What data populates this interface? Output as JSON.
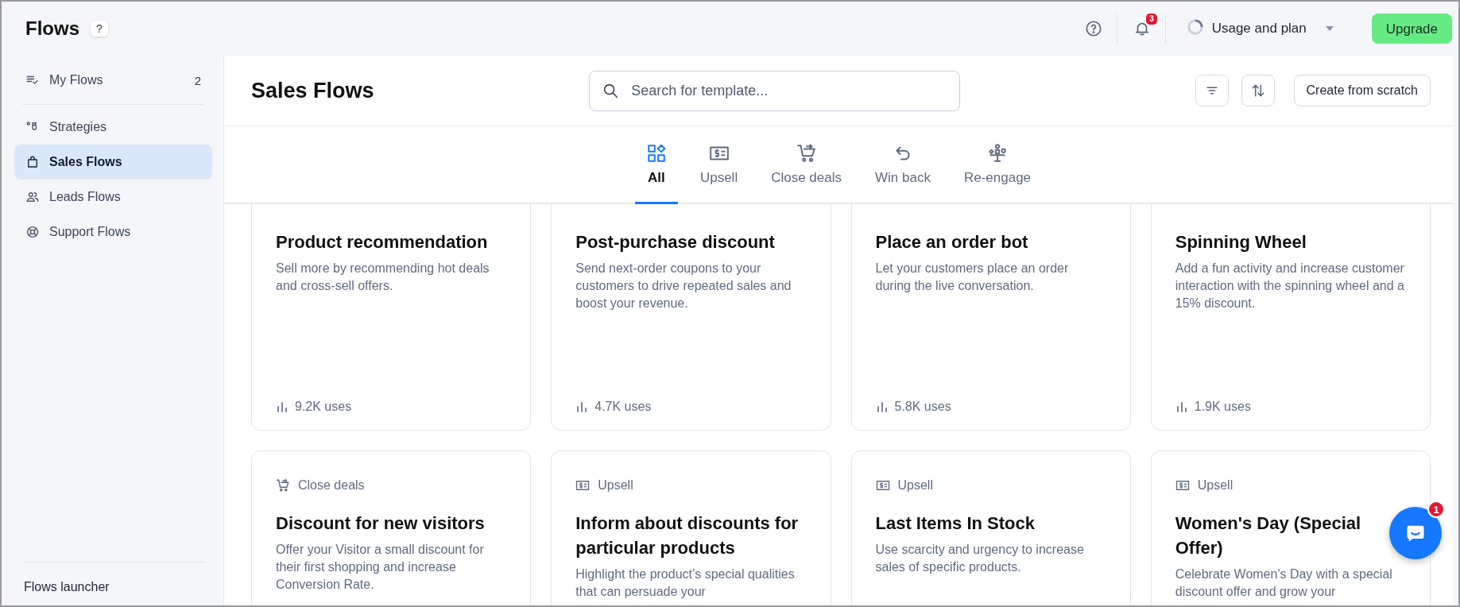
{
  "app": {
    "title": "Flows",
    "help_badge": "?"
  },
  "top_bar": {
    "notifications_count": "3",
    "usage_label": "Usage and plan",
    "upgrade_button": "Upgrade"
  },
  "sidebar": {
    "items": [
      {
        "label": "My Flows",
        "kind": "myflows",
        "count": "2",
        "selected": false
      },
      {
        "label": "Strategies",
        "kind": "strategies",
        "selected": false
      },
      {
        "label": "Sales Flows",
        "kind": "sales",
        "selected": true
      },
      {
        "label": "Leads Flows",
        "kind": "leads",
        "selected": false
      },
      {
        "label": "Support Flows",
        "kind": "support",
        "selected": false
      }
    ],
    "footer": "Flows launcher"
  },
  "header": {
    "title": "Sales Flows",
    "search": {
      "placeholder": "Search for template..."
    },
    "create_button": "Create from scratch"
  },
  "tabs": [
    {
      "label": "All",
      "kind": "all",
      "selected": true
    },
    {
      "label": "Upsell",
      "kind": "upsell",
      "selected": false
    },
    {
      "label": "Close deals",
      "kind": "close",
      "selected": false
    },
    {
      "label": "Win back",
      "kind": "winback",
      "selected": false
    },
    {
      "label": "Re-engage",
      "kind": "reengage",
      "selected": false
    }
  ],
  "cards": [
    {
      "title": "Product recommendation",
      "description": "Sell more by recommending hot deals and cross-sell offers.",
      "uses": "9.2K uses"
    },
    {
      "title": "Post-purchase discount",
      "description": "Send next-order coupons to your customers to drive repeated sales and boost your revenue.",
      "uses": "4.7K uses"
    },
    {
      "title": "Place an order bot",
      "description": "Let your customers place an order during the live conversation.",
      "uses": "5.8K uses"
    },
    {
      "title": "Spinning Wheel",
      "description": "Add a fun activity and increase customer interaction with the spinning wheel and a 15% discount.",
      "uses": "1.9K uses"
    },
    {
      "tag": {
        "label": "Close deals",
        "kind": "close"
      },
      "title": "Discount for new visitors",
      "description": "Offer your Visitor a small discount for their first shopping and increase Conversion Rate."
    },
    {
      "tag": {
        "label": "Upsell",
        "kind": "upsell"
      },
      "title": "Inform about discounts for particular products",
      "description": "Highlight the product’s special qualities that can persuade your"
    },
    {
      "tag": {
        "label": "Upsell",
        "kind": "upsell"
      },
      "title": "Last Items In Stock",
      "description": "Use scarcity and urgency to increase sales of specific products."
    },
    {
      "tag": {
        "label": "Upsell",
        "kind": "upsell"
      },
      "title": "Women's Day (Special Offer)",
      "description": "Celebrate Women's Day with a special discount offer and grow your"
    }
  ],
  "chat": {
    "badge": "1"
  }
}
